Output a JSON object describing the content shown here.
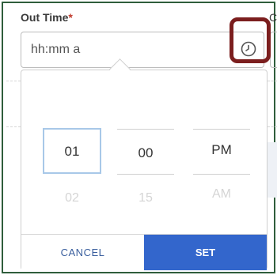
{
  "field": {
    "label": "Out Time",
    "required_mark": "*",
    "next_label_fragment": "C",
    "placeholder": "hh:mm a"
  },
  "picker": {
    "hour": {
      "selected": "01",
      "next": "02"
    },
    "minute": {
      "selected": "00",
      "next": "15"
    },
    "period": {
      "selected": "PM",
      "next": "AM"
    },
    "cancel_label": "CANCEL",
    "set_label": "SET"
  },
  "icons": {
    "clock": "clock-icon"
  },
  "colors": {
    "frame": "#2f5e3c",
    "highlight": "#7b1e1e",
    "primary": "#3366cc",
    "required": "#c0392b"
  }
}
